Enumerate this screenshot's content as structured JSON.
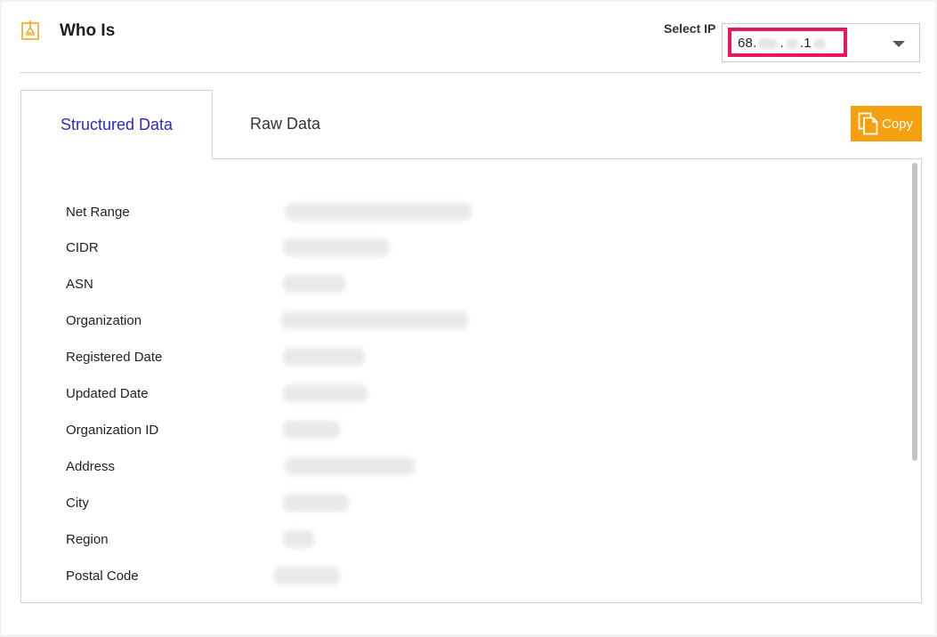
{
  "header": {
    "title": "Who Is",
    "select_label": "Select IP",
    "selected_ip": "68.",
    "selected_ip_mid": ".",
    "selected_ip_tail": ".1"
  },
  "tabs": [
    {
      "label": "Structured Data",
      "active": true
    },
    {
      "label": "Raw Data",
      "active": false
    }
  ],
  "actions": {
    "copy_label": "Copy"
  },
  "fields": [
    {
      "label": "Net Range"
    },
    {
      "label": "CIDR"
    },
    {
      "label": "ASN"
    },
    {
      "label": "Organization"
    },
    {
      "label": "Registered Date"
    },
    {
      "label": "Updated Date"
    },
    {
      "label": "Organization ID"
    },
    {
      "label": "Address"
    },
    {
      "label": "City"
    },
    {
      "label": "Region"
    },
    {
      "label": "Postal Code"
    }
  ],
  "colors": {
    "accent": "#2d2bbf",
    "copy_button": "#f5a10f",
    "highlight": "#ec1660"
  }
}
